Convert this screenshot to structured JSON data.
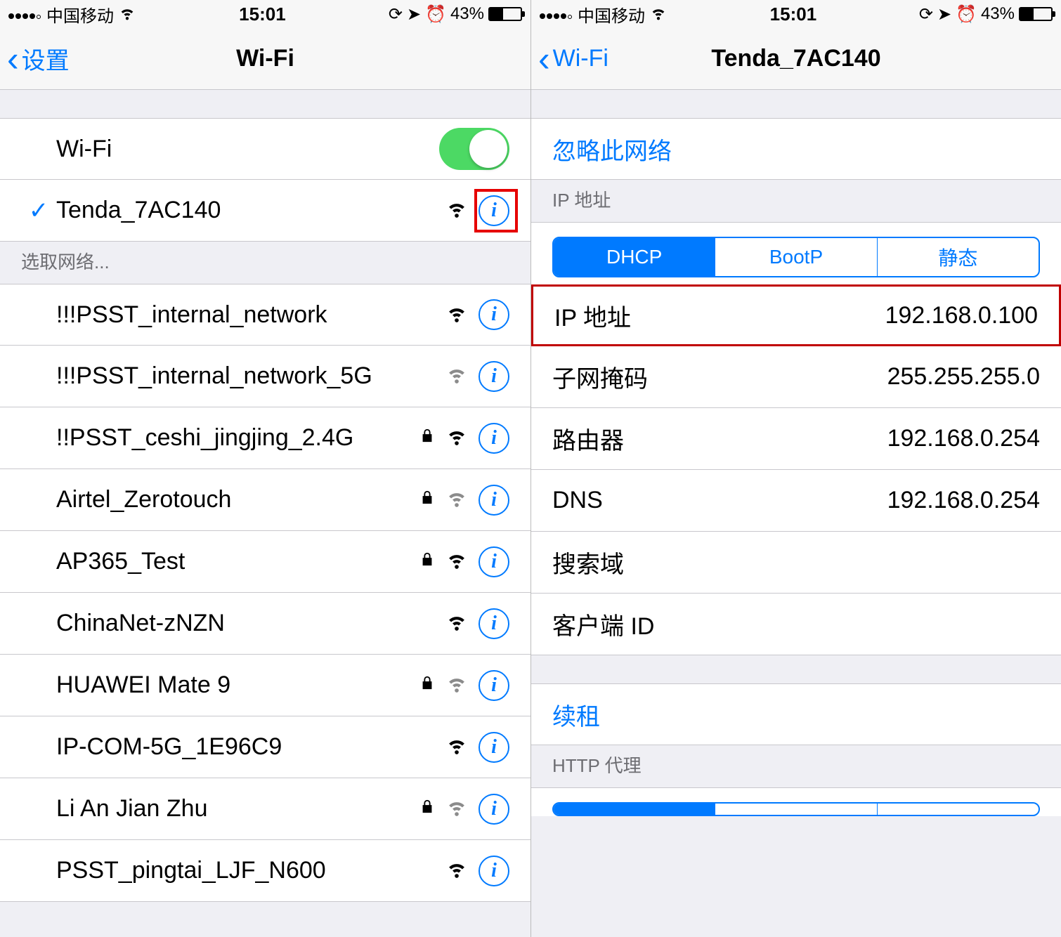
{
  "status": {
    "carrier": "中国移动",
    "time": "15:01",
    "battery_pct": "43%"
  },
  "left": {
    "back_label": "设置",
    "title": "Wi-Fi",
    "wifi_row_label": "Wi-Fi",
    "connected_network": "Tenda_7AC140",
    "choose_header": "选取网络...",
    "networks": [
      {
        "name": "!!!PSST_internal_network",
        "locked": false,
        "strong": true
      },
      {
        "name": "!!!PSST_internal_network_5G",
        "locked": false,
        "strong": false
      },
      {
        "name": "!!PSST_ceshi_jingjing_2.4G",
        "locked": true,
        "strong": true
      },
      {
        "name": "Airtel_Zerotouch",
        "locked": true,
        "strong": false
      },
      {
        "name": "AP365_Test",
        "locked": true,
        "strong": true
      },
      {
        "name": "ChinaNet-zNZN",
        "locked": false,
        "strong": true
      },
      {
        "name": "HUAWEI Mate 9",
        "locked": true,
        "strong": false
      },
      {
        "name": "IP-COM-5G_1E96C9",
        "locked": false,
        "strong": true
      },
      {
        "name": "Li An Jian Zhu",
        "locked": true,
        "strong": false
      },
      {
        "name": "PSST_pingtai_LJF_N600",
        "locked": false,
        "strong": true
      }
    ]
  },
  "right": {
    "back_label": "Wi-Fi",
    "title": "Tenda_7AC140",
    "forget_label": "忽略此网络",
    "ip_section_header": "IP 地址",
    "seg": {
      "dhcp": "DHCP",
      "bootp": "BootP",
      "static": "静态"
    },
    "rows": {
      "ip_label": "IP 地址",
      "ip_value": "192.168.0.100",
      "mask_label": "子网掩码",
      "mask_value": "255.255.255.0",
      "router_label": "路由器",
      "router_value": "192.168.0.254",
      "dns_label": "DNS",
      "dns_value": "192.168.0.254",
      "search_label": "搜索域",
      "search_value": "",
      "client_label": "客户端 ID",
      "client_value": ""
    },
    "renew_label": "续租",
    "proxy_header": "HTTP 代理"
  }
}
